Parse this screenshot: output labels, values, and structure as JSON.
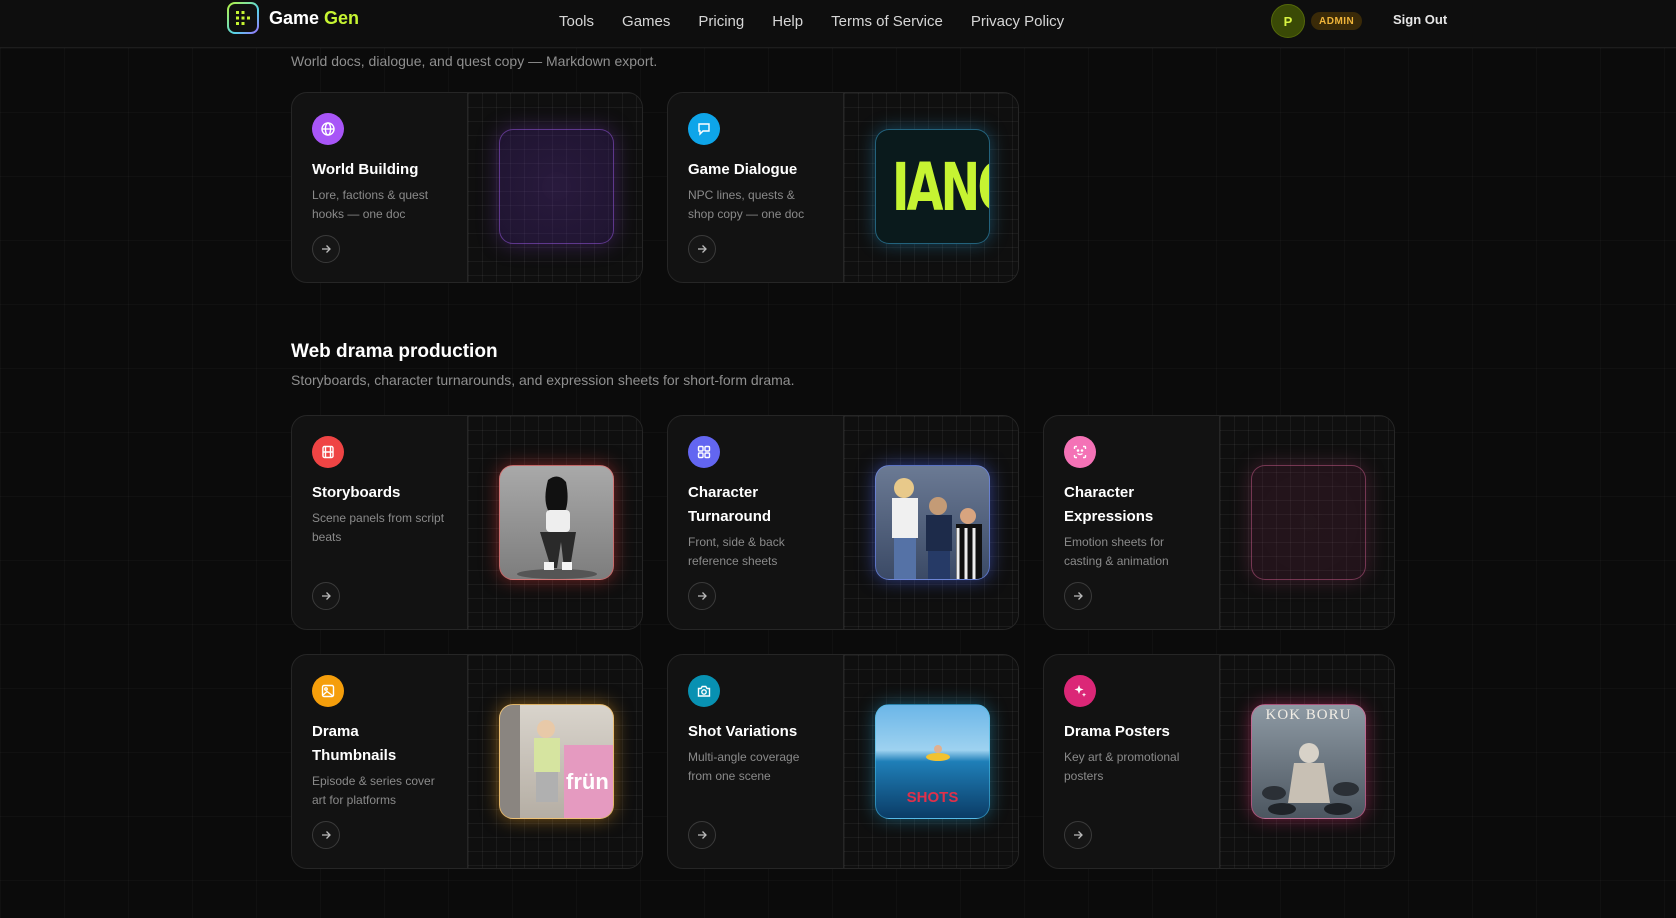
{
  "brand": {
    "name_part1": "Game",
    "name_part2": "Gen"
  },
  "nav": [
    "Tools",
    "Games",
    "Pricing",
    "Help",
    "Terms of Service",
    "Privacy Policy"
  ],
  "user": {
    "initial": "P",
    "role_badge": "ADMIN",
    "signout_label": "Sign Out"
  },
  "writing_section": {
    "subtitle": "World docs, dialogue, and quest copy — Markdown export.",
    "cards": [
      {
        "title": "World Building",
        "desc": "Lore, factions & quest hooks — one doc",
        "icon": "globe-icon",
        "color": "#a855f7"
      },
      {
        "title": "Game Dialogue",
        "desc": "NPC lines, quests & shop copy — one doc",
        "icon": "chat-bubble-icon",
        "color": "#0ea5e9",
        "thumb_text": "IANC"
      }
    ]
  },
  "drama_section": {
    "title": "Web drama production",
    "subtitle": "Storyboards, character turnarounds, and expression sheets for short-form drama.",
    "cards": [
      {
        "title": "Storyboards",
        "desc": "Scene panels from script beats",
        "icon": "film-icon",
        "color": "#ef4444"
      },
      {
        "title": "Character Turnaround",
        "desc": "Front, side & back reference sheets",
        "icon": "grid-icon",
        "color": "#6366f1"
      },
      {
        "title": "Character Expressions",
        "desc": "Emotion sheets for casting & animation",
        "icon": "face-scan-icon",
        "color": "#f472b6"
      },
      {
        "title": "Drama Thumbnails",
        "desc": "Episode & series cover art for platforms",
        "icon": "image-icon",
        "color": "#f59e0b",
        "thumb_text": "frün"
      },
      {
        "title": "Shot Variations",
        "desc": "Multi-angle coverage from one scene",
        "icon": "camera-icon",
        "color": "#0891b2",
        "thumb_text": "SHOTS"
      },
      {
        "title": "Drama Posters",
        "desc": "Key art & promotional posters",
        "icon": "sparkles-icon",
        "color": "#db2777",
        "thumb_text": "KOK BORU"
      }
    ]
  }
}
